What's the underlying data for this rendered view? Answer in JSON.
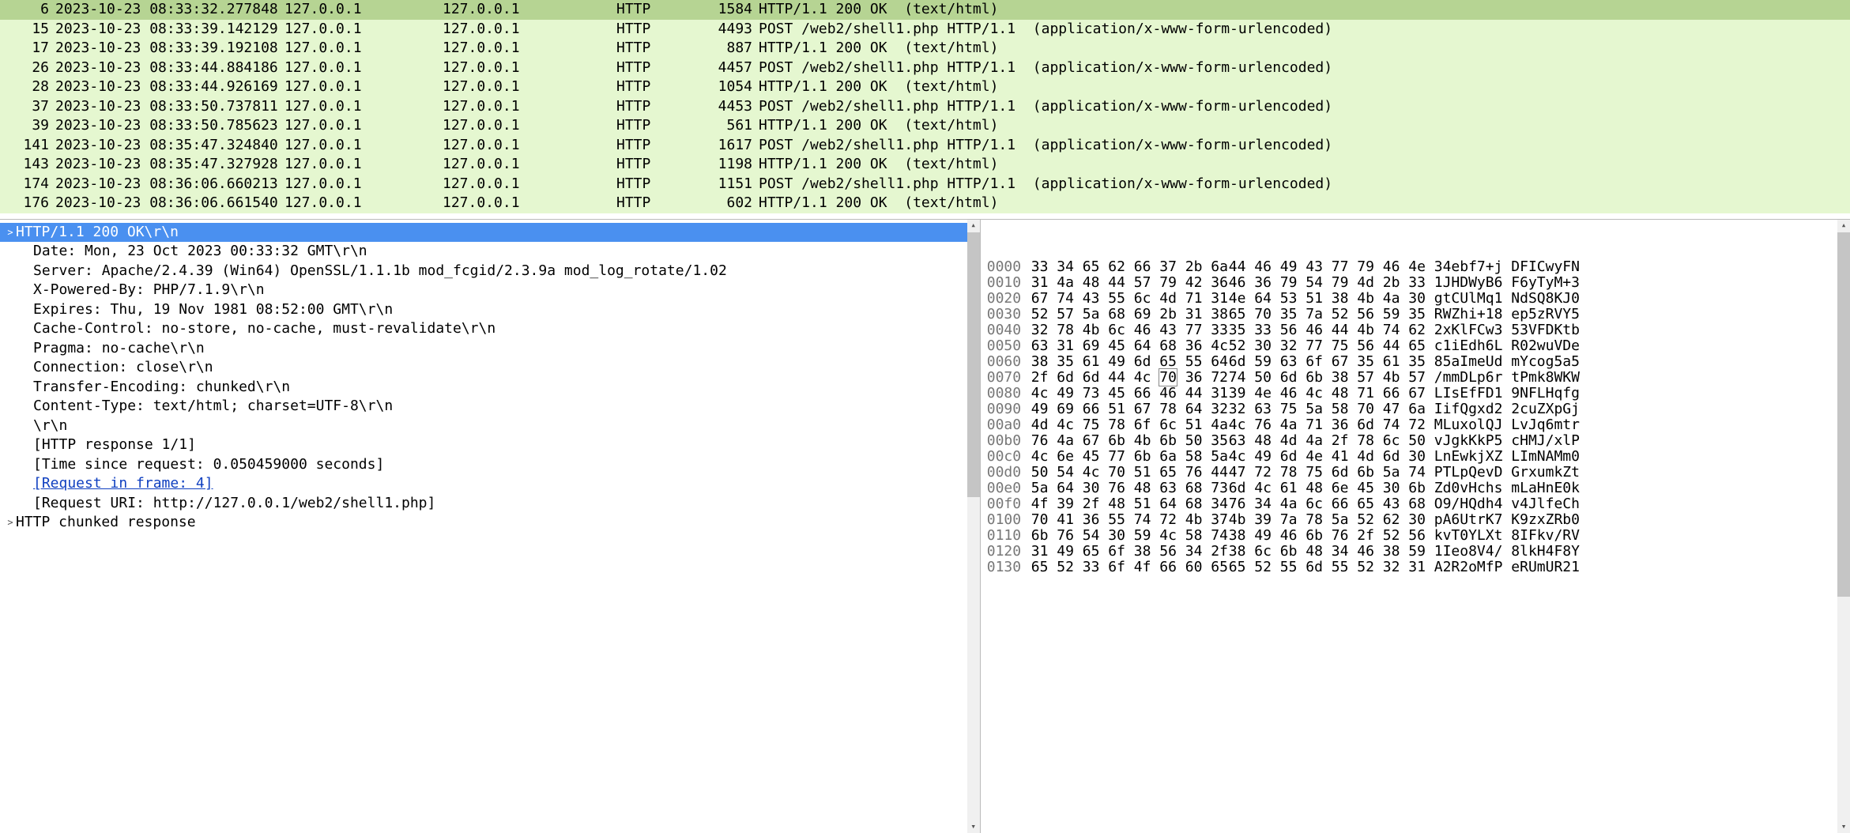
{
  "packets": [
    {
      "no": "6",
      "time": "2023-10-23 08:33:32.277848",
      "src": "127.0.0.1",
      "dst": "127.0.0.1",
      "prot": "HTTP",
      "len": "1584",
      "info": "HTTP/1.1 200 OK  (text/html)",
      "selected": true
    },
    {
      "no": "15",
      "time": "2023-10-23 08:33:39.142129",
      "src": "127.0.0.1",
      "dst": "127.0.0.1",
      "prot": "HTTP",
      "len": "4493",
      "info": "POST /web2/shell1.php HTTP/1.1  (application/x-www-form-urlencoded)"
    },
    {
      "no": "17",
      "time": "2023-10-23 08:33:39.192108",
      "src": "127.0.0.1",
      "dst": "127.0.0.1",
      "prot": "HTTP",
      "len": "887",
      "info": "HTTP/1.1 200 OK  (text/html)"
    },
    {
      "no": "26",
      "time": "2023-10-23 08:33:44.884186",
      "src": "127.0.0.1",
      "dst": "127.0.0.1",
      "prot": "HTTP",
      "len": "4457",
      "info": "POST /web2/shell1.php HTTP/1.1  (application/x-www-form-urlencoded)"
    },
    {
      "no": "28",
      "time": "2023-10-23 08:33:44.926169",
      "src": "127.0.0.1",
      "dst": "127.0.0.1",
      "prot": "HTTP",
      "len": "1054",
      "info": "HTTP/1.1 200 OK  (text/html)"
    },
    {
      "no": "37",
      "time": "2023-10-23 08:33:50.737811",
      "src": "127.0.0.1",
      "dst": "127.0.0.1",
      "prot": "HTTP",
      "len": "4453",
      "info": "POST /web2/shell1.php HTTP/1.1  (application/x-www-form-urlencoded)"
    },
    {
      "no": "39",
      "time": "2023-10-23 08:33:50.785623",
      "src": "127.0.0.1",
      "dst": "127.0.0.1",
      "prot": "HTTP",
      "len": "561",
      "info": "HTTP/1.1 200 OK  (text/html)"
    },
    {
      "no": "141",
      "time": "2023-10-23 08:35:47.324840",
      "src": "127.0.0.1",
      "dst": "127.0.0.1",
      "prot": "HTTP",
      "len": "1617",
      "info": "POST /web2/shell1.php HTTP/1.1  (application/x-www-form-urlencoded)"
    },
    {
      "no": "143",
      "time": "2023-10-23 08:35:47.327928",
      "src": "127.0.0.1",
      "dst": "127.0.0.1",
      "prot": "HTTP",
      "len": "1198",
      "info": "HTTP/1.1 200 OK  (text/html)"
    },
    {
      "no": "174",
      "time": "2023-10-23 08:36:06.660213",
      "src": "127.0.0.1",
      "dst": "127.0.0.1",
      "prot": "HTTP",
      "len": "1151",
      "info": "POST /web2/shell1.php HTTP/1.1  (application/x-www-form-urlencoded)"
    },
    {
      "no": "176",
      "time": "2023-10-23 08:36:06.661540",
      "src": "127.0.0.1",
      "dst": "127.0.0.1",
      "prot": "HTTP",
      "len": "602",
      "info": "HTTP/1.1 200 OK  (text/html)"
    }
  ],
  "details": [
    {
      "tri": ">",
      "indent": 0,
      "text": "HTTP/1.1 200 OK\\r\\n",
      "selected": true
    },
    {
      "tri": "",
      "indent": 1,
      "text": "Date: Mon, 23 Oct 2023 00:33:32 GMT\\r\\n"
    },
    {
      "tri": "",
      "indent": 1,
      "text": "Server: Apache/2.4.39 (Win64) OpenSSL/1.1.1b mod_fcgid/2.3.9a mod_log_rotate/1.02"
    },
    {
      "tri": "",
      "indent": 1,
      "text": "X-Powered-By: PHP/7.1.9\\r\\n"
    },
    {
      "tri": "",
      "indent": 1,
      "text": "Expires: Thu, 19 Nov 1981 08:52:00 GMT\\r\\n"
    },
    {
      "tri": "",
      "indent": 1,
      "text": "Cache-Control: no-store, no-cache, must-revalidate\\r\\n"
    },
    {
      "tri": "",
      "indent": 1,
      "text": "Pragma: no-cache\\r\\n"
    },
    {
      "tri": "",
      "indent": 1,
      "text": "Connection: close\\r\\n"
    },
    {
      "tri": "",
      "indent": 1,
      "text": "Transfer-Encoding: chunked\\r\\n"
    },
    {
      "tri": "",
      "indent": 1,
      "text": "Content-Type: text/html; charset=UTF-8\\r\\n"
    },
    {
      "tri": "",
      "indent": 1,
      "text": "\\r\\n"
    },
    {
      "tri": "",
      "indent": 1,
      "text": "[HTTP response 1/1]"
    },
    {
      "tri": "",
      "indent": 1,
      "text": "[Time since request: 0.050459000 seconds]"
    },
    {
      "tri": "",
      "indent": 1,
      "link": true,
      "text": "[Request in frame: 4]"
    },
    {
      "tri": "",
      "indent": 1,
      "text": "[Request URI: http://127.0.0.1/web2/shell1.php]"
    },
    {
      "tri": ">",
      "indent": 0,
      "text": "HTTP chunked response"
    }
  ],
  "hex": [
    {
      "off": "0000",
      "b1": "33 34 65 62 66 37 2b 6a",
      "b2": "44 46 49 43 77 79 46 4e",
      "asc": "34ebf7+j DFICwyFN"
    },
    {
      "off": "0010",
      "b1": "31 4a 48 44 57 79 42 36",
      "b2": "46 36 79 54 79 4d 2b 33",
      "asc": "1JHDWyB6 F6yTyM+3"
    },
    {
      "off": "0020",
      "b1": "67 74 43 55 6c 4d 71 31",
      "b2": "4e 64 53 51 38 4b 4a 30",
      "asc": "gtCUlMq1 NdSQ8KJ0"
    },
    {
      "off": "0030",
      "b1": "52 57 5a 68 69 2b 31 38",
      "b2": "65 70 35 7a 52 56 59 35",
      "asc": "RWZhi+18 ep5zRVY5"
    },
    {
      "off": "0040",
      "b1": "32 78 4b 6c 46 43 77 33",
      "b2": "35 33 56 46 44 4b 74 62",
      "asc": "2xKlFCw3 53VFDKtb"
    },
    {
      "off": "0050",
      "b1": "63 31 69 45 64 68 36 4c",
      "b2": "52 30 32 77 75 56 44 65",
      "asc": "c1iEdh6L R02wuVDe"
    },
    {
      "off": "0060",
      "b1": "38 35 61 49 6d 65 55 64",
      "b2": "6d 59 63 6f 67 35 61 35",
      "asc": "85aImeUd mYcog5a5"
    },
    {
      "off": "0070",
      "b1": "2f 6d 6d 44 4c ",
      "b1sel": "70",
      "b1after": " 36 72",
      "b2": "74 50 6d 6b 38 57 4b 57",
      "asc": "/mmDLp6r tPmk8WKW"
    },
    {
      "off": "0080",
      "b1": "4c 49 73 45 66 46 44 31",
      "b2": "39 4e 46 4c 48 71 66 67",
      "asc": "LIsEfFD1 9NFLHqfg"
    },
    {
      "off": "0090",
      "b1": "49 69 66 51 67 78 64 32",
      "b2": "32 63 75 5a 58 70 47 6a",
      "asc": "IifQgxd2 2cuZXpGj"
    },
    {
      "off": "00a0",
      "b1": "4d 4c 75 78 6f 6c 51 4a",
      "b2": "4c 76 4a 71 36 6d 74 72",
      "asc": "MLuxolQJ LvJq6mtr"
    },
    {
      "off": "00b0",
      "b1": "76 4a 67 6b 4b 6b 50 35",
      "b2": "63 48 4d 4a 2f 78 6c 50",
      "asc": "vJgkKkP5 cHMJ/xlP"
    },
    {
      "off": "00c0",
      "b1": "4c 6e 45 77 6b 6a 58 5a",
      "b2": "4c 49 6d 4e 41 4d 6d 30",
      "asc": "LnEwkjXZ LImNAMm0"
    },
    {
      "off": "00d0",
      "b1": "50 54 4c 70 51 65 76 44",
      "b2": "47 72 78 75 6d 6b 5a 74",
      "asc": "PTLpQevD GrxumkZt"
    },
    {
      "off": "00e0",
      "b1": "5a 64 30 76 48 63 68 73",
      "b2": "6d 4c 61 48 6e 45 30 6b",
      "asc": "Zd0vHchs mLaHnE0k"
    },
    {
      "off": "00f0",
      "b1": "4f 39 2f 48 51 64 68 34",
      "b2": "76 34 4a 6c 66 65 43 68",
      "asc": "O9/HQdh4 v4JlfeCh"
    },
    {
      "off": "0100",
      "b1": "70 41 36 55 74 72 4b 37",
      "b2": "4b 39 7a 78 5a 52 62 30",
      "asc": "pA6UtrK7 K9zxZRb0"
    },
    {
      "off": "0110",
      "b1": "6b 76 54 30 59 4c 58 74",
      "b2": "38 49 46 6b 76 2f 52 56",
      "asc": "kvT0YLXt 8IFkv/RV"
    },
    {
      "off": "0120",
      "b1": "31 49 65 6f 38 56 34 2f",
      "b2": "38 6c 6b 48 34 46 38 59",
      "asc": "1Ieo8V4/ 8lkH4F8Y"
    },
    {
      "off": "0130",
      "b1": "65 52 33 6f 4f 66 60 65",
      "b2": "65 52 55 6d 55 52 32 31",
      "asc": "A2R2oMfP eRUmUR21"
    }
  ]
}
